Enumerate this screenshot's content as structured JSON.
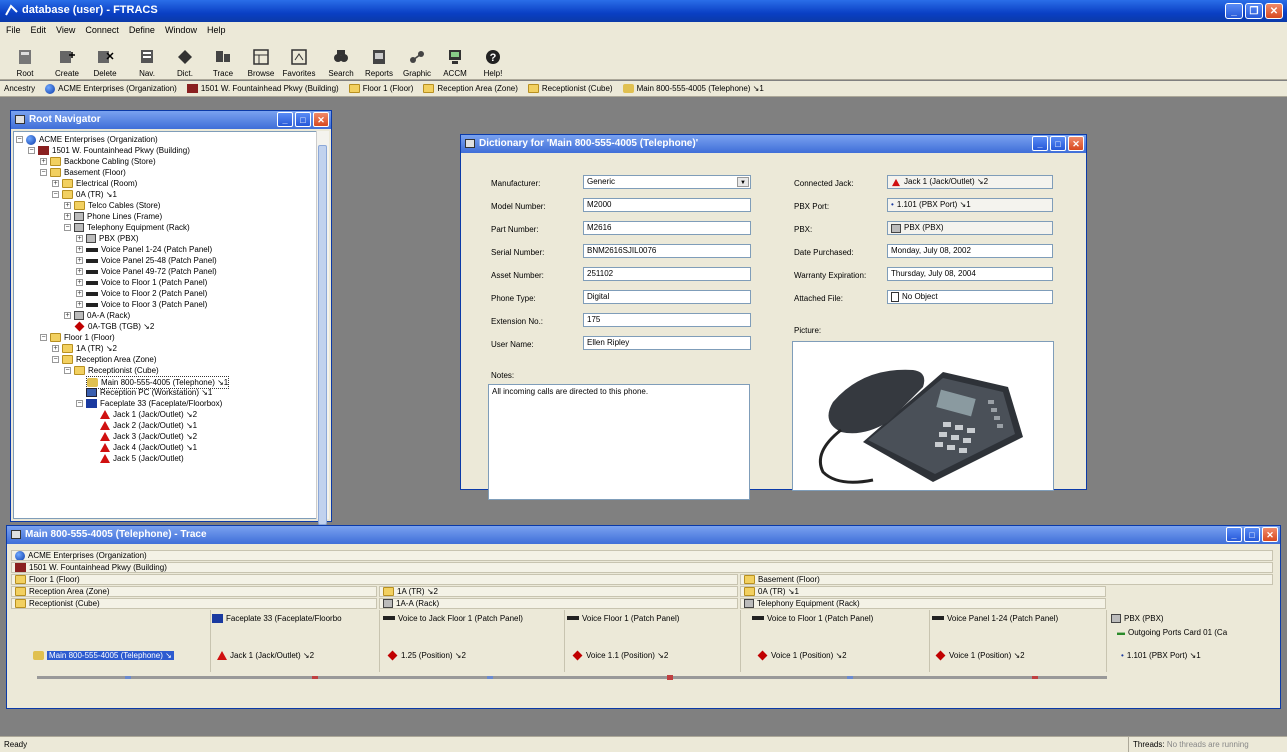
{
  "window": {
    "title": "database (user) - FTRACS"
  },
  "menu": [
    "File",
    "Edit",
    "View",
    "Connect",
    "Define",
    "Window",
    "Help"
  ],
  "toolbar": [
    {
      "label": "Root",
      "icon": "root-icon"
    },
    {
      "label": "Create",
      "icon": "create-icon"
    },
    {
      "label": "Delete",
      "icon": "delete-icon"
    },
    {
      "label": "Nav.",
      "icon": "navigator-icon"
    },
    {
      "label": "Dict.",
      "icon": "dictionary-icon"
    },
    {
      "label": "Trace",
      "icon": "trace-icon"
    },
    {
      "label": "Browse",
      "icon": "browse-icon"
    },
    {
      "label": "Favorites",
      "icon": "favorites-icon"
    },
    {
      "label": "Search",
      "icon": "search-icon"
    },
    {
      "label": "Reports",
      "icon": "reports-icon"
    },
    {
      "label": "Graphic",
      "icon": "graphic-icon"
    },
    {
      "label": "ACCM",
      "icon": "accm-icon"
    },
    {
      "label": "Help!",
      "icon": "help-icon"
    }
  ],
  "ancestry": {
    "label": "Ancestry",
    "items": [
      "ACME Enterprises (Organization)",
      "1501 W. Fountainhead Pkwy (Building)",
      "Floor 1 (Floor)",
      "Reception Area (Zone)",
      "Receptionist (Cube)",
      "Main 800-555-4005 (Telephone) ↘1"
    ]
  },
  "navigator": {
    "title": "Root Navigator",
    "tree": [
      "ACME Enterprises (Organization)",
      "1501 W. Fountainhead Pkwy (Building)",
      "Backbone Cabling (Store)",
      "Basement (Floor)",
      "Electrical (Room)",
      "0A (TR) ↘1",
      "Telco Cables (Store)",
      "Phone Lines (Frame)",
      "Telephony Equipment (Rack)",
      "PBX (PBX)",
      "Voice Panel 1-24 (Patch Panel)",
      "Voice Panel 25-48 (Patch Panel)",
      "Voice Panel 49-72 (Patch Panel)",
      "Voice to Floor 1 (Patch Panel)",
      "Voice to Floor 2 (Patch Panel)",
      "Voice to Floor 3 (Patch Panel)",
      "0A-A (Rack)",
      "0A-TGB (TGB) ↘2",
      "Floor 1 (Floor)",
      "1A (TR) ↘2",
      "Reception Area (Zone)",
      "Receptionist (Cube)",
      "Main 800-555-4005 (Telephone) ↘1",
      "Reception PC (Workstation) ↘1",
      "Faceplate 33 (Faceplate/Floorbox)",
      "Jack 1 (Jack/Outlet) ↘2",
      "Jack 2 (Jack/Outlet) ↘1",
      "Jack 3 (Jack/Outlet) ↘2",
      "Jack 4 (Jack/Outlet) ↘1",
      "Jack 5 (Jack/Outlet)"
    ]
  },
  "dictionary": {
    "title": "Dictionary for 'Main 800-555-4005 (Telephone)'",
    "left": [
      {
        "label": "Manufacturer:",
        "value": "Generic"
      },
      {
        "label": "Model Number:",
        "value": "M2000"
      },
      {
        "label": "Part Number:",
        "value": "M2616"
      },
      {
        "label": "Serial Number:",
        "value": "BNM2616SJIL0076"
      },
      {
        "label": "Asset Number:",
        "value": "251102"
      },
      {
        "label": "Phone Type:",
        "value": "Digital"
      },
      {
        "label": "Extension No.:",
        "value": "175"
      },
      {
        "label": "User Name:",
        "value": "Ellen Ripley"
      }
    ],
    "notes_label": "Notes:",
    "notes": "All incoming calls are directed to this phone.",
    "right": [
      {
        "label": "Connected Jack:",
        "value": "Jack 1 (Jack/Outlet) ↘2"
      },
      {
        "label": "PBX Port:",
        "value": "1.101 (PBX Port) ↘1"
      },
      {
        "label": "PBX:",
        "value": "PBX (PBX)"
      },
      {
        "label": "Date Purchased:",
        "value": "Monday, July 08, 2002"
      },
      {
        "label": "Warranty Expiration:",
        "value": "Thursday, July 08, 2004"
      },
      {
        "label": "Attached File:",
        "value": "No Object"
      }
    ],
    "picture_label": "Picture:"
  },
  "trace": {
    "title": "Main 800-555-4005 (Telephone) - Trace",
    "org": "ACME Enterprises (Organization)",
    "building": "1501 W. Fountainhead Pkwy (Building)",
    "floor1": "Floor 1 (Floor)",
    "basement": "Basement (Floor)",
    "zone": "Reception Area (Zone)",
    "tr1a": "1A (TR) ↘2",
    "tr0a": "0A (TR) ↘1",
    "cube": "Receptionist (Cube)",
    "rack1a": "1A-A (Rack)",
    "rack_tel": "Telephony Equipment (Rack)",
    "columns": [
      {
        "parent": "",
        "item": "Main 800-555-4005 (Telephone) ↘"
      },
      {
        "parent": "Faceplate 33 (Faceplate/Floorbo",
        "item": "Jack 1 (Jack/Outlet) ↘2"
      },
      {
        "parent": "Voice to Jack Floor 1 (Patch Panel)",
        "item": "1.25 (Position) ↘2"
      },
      {
        "parent": "Voice Floor 1 (Patch Panel)",
        "item": "Voice 1.1 (Position) ↘2"
      },
      {
        "parent": "Voice to Floor 1 (Patch Panel)",
        "item": "Voice 1 (Position) ↘2"
      },
      {
        "parent": "Voice Panel 1-24 (Patch Panel)",
        "item": "Voice 1 (Position) ↘2"
      },
      {
        "parent": "PBX (PBX)",
        "sub": "Outgoing Ports Card 01 (Ca",
        "item": "1.101 (PBX Port) ↘1"
      }
    ]
  },
  "status": {
    "left": "Ready",
    "threads_label": "Threads:",
    "threads_value": "No threads are running"
  },
  "colors": {
    "titlebar": "#0a3fc4",
    "face": "#ece9d8",
    "selection": "#2d5bd0",
    "jack": "#d01010"
  }
}
